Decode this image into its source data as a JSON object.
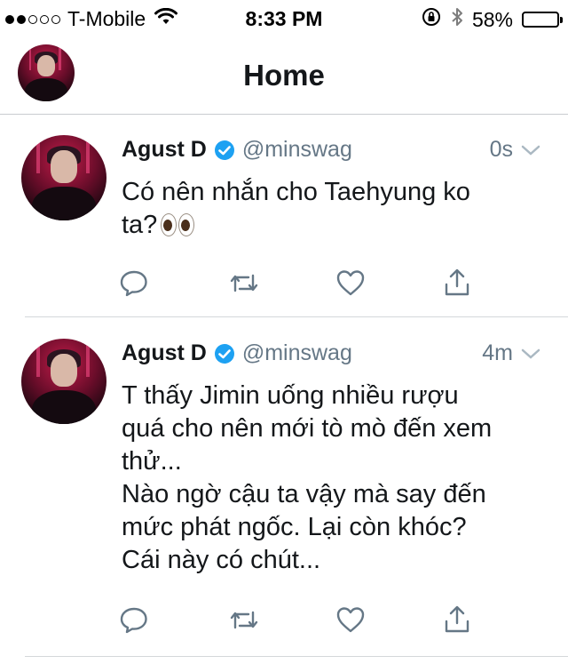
{
  "status_bar": {
    "carrier": "T-Mobile",
    "time": "8:33 PM",
    "battery": "58%",
    "battery_level": 0.58,
    "signal_bars_filled": 2,
    "signal_bars_total": 5
  },
  "nav": {
    "title": "Home"
  },
  "colors": {
    "verified": "#1da1f2",
    "secondary_text": "#657786",
    "action_icon": "#657786"
  },
  "tweets": [
    {
      "name": "Agust D",
      "handle": "@minswag",
      "time": "0s",
      "lines": [
        "Có nên nhắn cho Taehyung ko",
        "ta?"
      ],
      "emoji": "eyes-emoji"
    },
    {
      "name": "Agust D",
      "handle": "@minswag",
      "time": "4m",
      "lines": [
        "T thấy Jimin uống nhiều rượu",
        "quá cho nên mới tò mò đến xem",
        "thử...",
        "Nào ngờ cậu ta vậy mà say đến",
        "mức phát ngốc. Lại còn khóc?",
        "Cái này có chút..."
      ]
    }
  ],
  "icons": [
    "reply-icon",
    "retweet-icon",
    "like-icon",
    "share-icon",
    "verified-icon",
    "chevron-down-icon",
    "wifi-icon",
    "orientation-lock-icon",
    "bluetooth-icon",
    "battery-icon"
  ]
}
